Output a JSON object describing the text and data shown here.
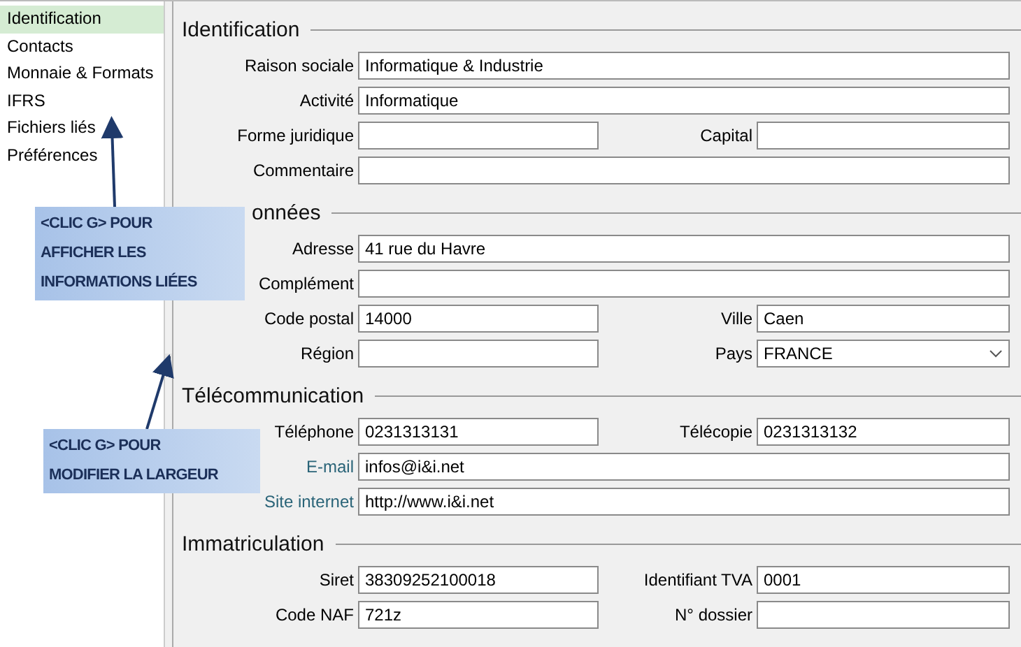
{
  "sidebar": {
    "items": [
      {
        "label": "Identification",
        "selected": true
      },
      {
        "label": "Contacts",
        "selected": false
      },
      {
        "label": "Monnaie & Formats",
        "selected": false
      },
      {
        "label": "IFRS",
        "selected": false
      },
      {
        "label": "Fichiers liés",
        "selected": false
      },
      {
        "label": "Préférences",
        "selected": false
      }
    ]
  },
  "sections": [
    {
      "title": "Identification",
      "covered": false,
      "rows": [
        [
          {
            "label": "Raison sociale",
            "kind": "text",
            "link": false,
            "value": "Informatique & Industrie"
          }
        ],
        [
          {
            "label": "Activité",
            "kind": "text",
            "link": false,
            "value": "Informatique"
          }
        ],
        [
          {
            "label": "Forme juridique",
            "kind": "text",
            "link": false
          },
          {
            "label": "Capital",
            "kind": "text",
            "link": false
          }
        ],
        [
          {
            "label": "Commentaire",
            "kind": "text",
            "link": false
          }
        ]
      ]
    },
    {
      "title": "onnées",
      "covered": true,
      "rows": [
        [
          {
            "label": "Adresse",
            "kind": "text",
            "link": false,
            "value": "41 rue du Havre"
          }
        ],
        [
          {
            "label": "Complément",
            "kind": "text",
            "link": false
          }
        ],
        [
          {
            "label": "Code postal",
            "kind": "text",
            "link": false,
            "value": "14000"
          },
          {
            "label": "Ville",
            "kind": "text",
            "link": false,
            "value": "Caen"
          }
        ],
        [
          {
            "label": "Région",
            "kind": "text",
            "link": false
          },
          {
            "label": "Pays",
            "kind": "select",
            "link": false,
            "value": "FRANCE"
          }
        ]
      ]
    },
    {
      "title": "Télécommunication",
      "covered": false,
      "rows": [
        [
          {
            "label": "Téléphone",
            "kind": "text",
            "link": false,
            "value": "0231313131"
          },
          {
            "label": "Télécopie",
            "kind": "text",
            "link": false,
            "value": "0231313132"
          }
        ],
        [
          {
            "label": "E-mail",
            "kind": "text",
            "link": true,
            "value": "infos@i&i.net"
          }
        ],
        [
          {
            "label": "Site internet",
            "kind": "text",
            "link": true,
            "value": "http://www.i&i.net"
          }
        ]
      ]
    },
    {
      "title": "Immatriculation",
      "covered": false,
      "rows": [
        [
          {
            "label": "Siret",
            "kind": "text",
            "link": false,
            "value": "38309252100018"
          },
          {
            "label": "Identifiant TVA",
            "kind": "text",
            "link": false,
            "value": "0001"
          }
        ],
        [
          {
            "label": "Code NAF",
            "kind": "text",
            "link": false,
            "value": "721z"
          },
          {
            "label": "N° dossier",
            "kind": "text",
            "link": false
          }
        ]
      ]
    }
  ],
  "callouts": [
    {
      "text": "<CLIC G> POUR\nAFFICHER LES\nINFORMATIONS LIÉES"
    },
    {
      "text": "<CLIC G> POUR\nMODIFIER LA LARGEUR"
    }
  ]
}
